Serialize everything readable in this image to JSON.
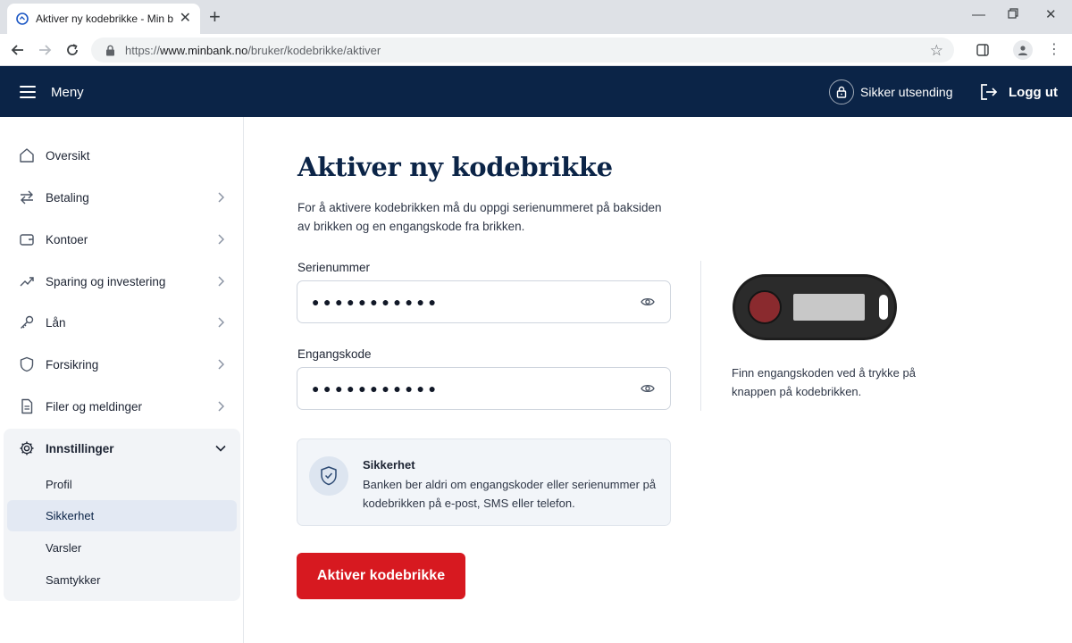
{
  "browser": {
    "tab_title": "Aktiver ny kodebrikke - Min bank",
    "url_prefix": "https://",
    "url_host": "www.minbank.no",
    "url_path": "/bruker/kodebrikke/aktiver"
  },
  "header": {
    "menu_label": "Meny",
    "secure_send_label": "Sikker utsending",
    "logout_label": "Logg ut",
    "background_color": "#0b2447"
  },
  "sidebar": {
    "items": [
      {
        "label": "Oversikt",
        "icon": "home-icon"
      },
      {
        "label": "Betaling",
        "icon": "transfer-arrows-icon"
      },
      {
        "label": "Kontoer",
        "icon": "wallet-icon"
      },
      {
        "label": "Sparing og investering",
        "icon": "trend-chart-icon"
      },
      {
        "label": "Lån",
        "icon": "key-icon"
      },
      {
        "label": "Forsikring",
        "icon": "shield-icon"
      },
      {
        "label": "Filer og meldinger",
        "icon": "document-icon"
      }
    ],
    "settings": {
      "label": "Innstillinger",
      "icon": "gear-icon",
      "expanded": true,
      "subitems": [
        "Profil",
        "Sikkerhet",
        "Varsler",
        "Samtykker"
      ],
      "active": "Sikkerhet"
    }
  },
  "main": {
    "title": "Aktiver ny kodebrikke",
    "intro": "For å aktivere kodebrikken må du oppgi serienummeret på baksiden av brikken og en engangskode fra brikken.",
    "serial": {
      "label": "Serienummer",
      "value": "●●●●●●●●●●●"
    },
    "otp": {
      "label": "Engangskode",
      "value": "●●●●●●●●●●●"
    },
    "token_caption": "Finn engangskoden ved å trykke på knappen på kodebrikken.",
    "security": {
      "title": "Sikkerhet",
      "text": "Banken ber aldri om engangskoder eller serienummer på kodebrikken på e-post, SMS eller telefon."
    },
    "submit_label": "Aktiver kodebrikke",
    "accent_color": "#d71920"
  }
}
